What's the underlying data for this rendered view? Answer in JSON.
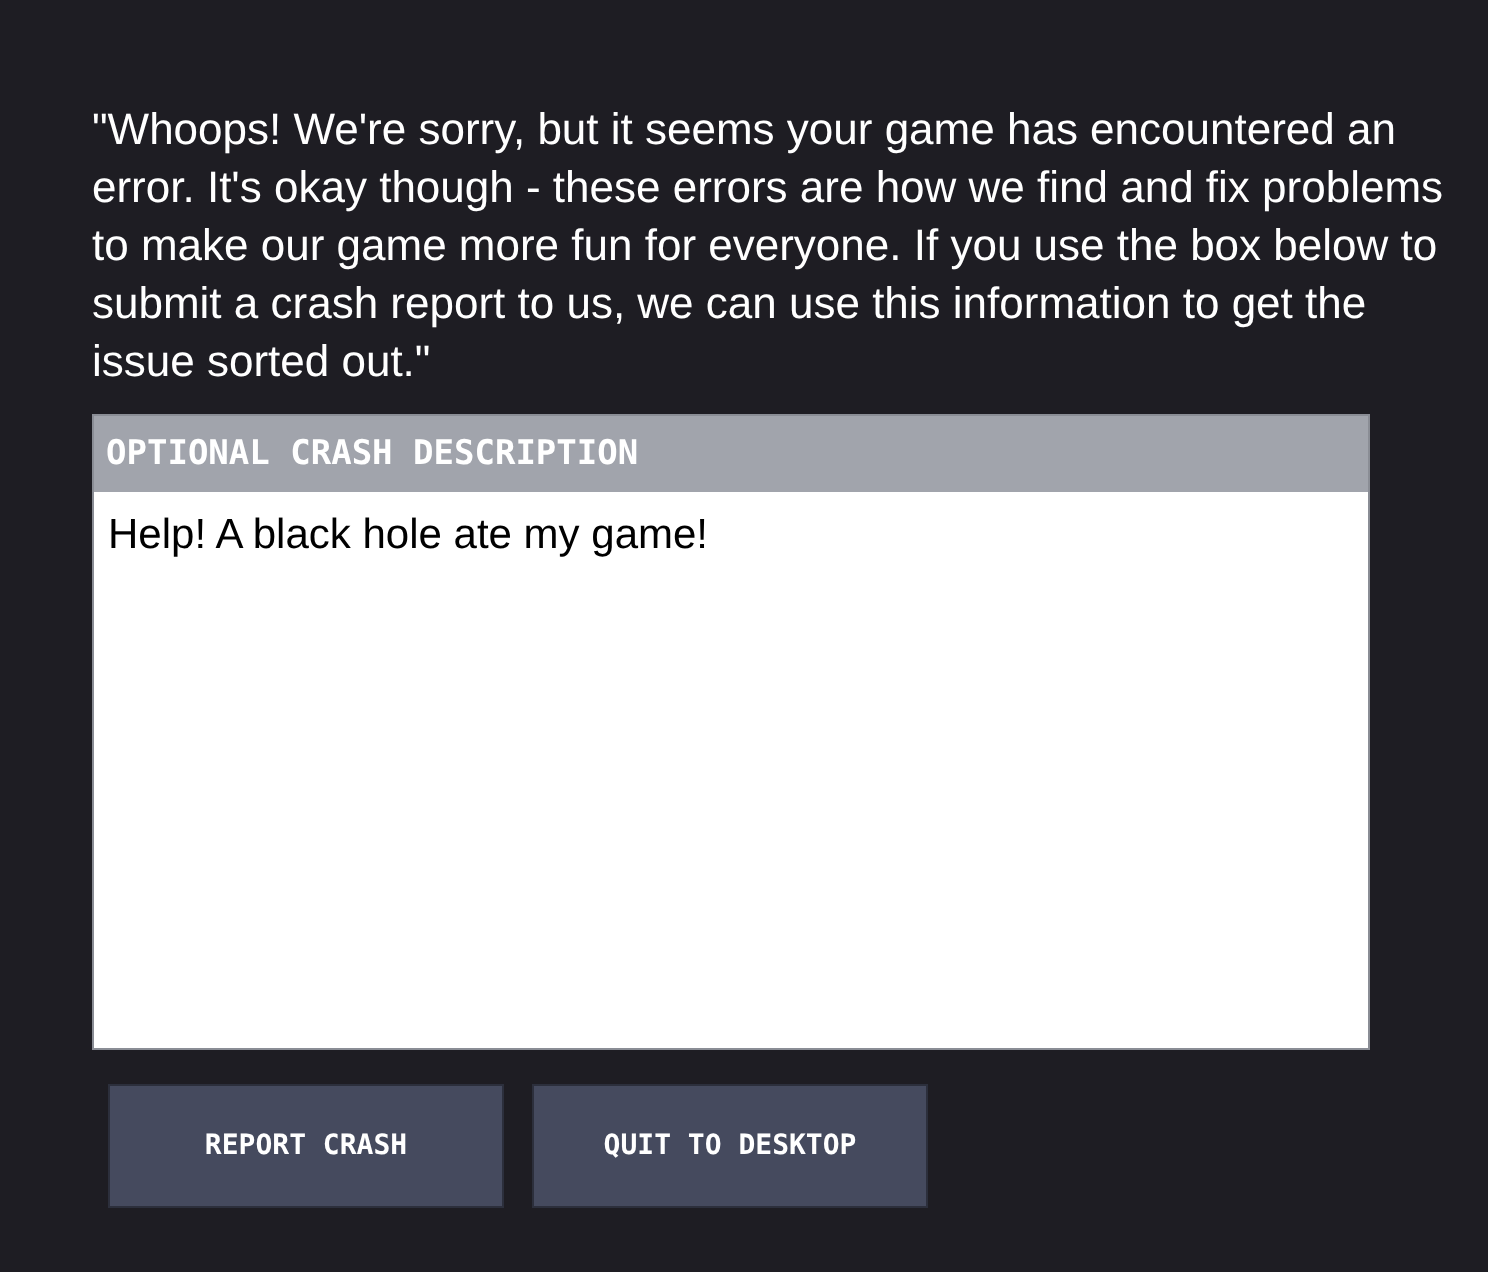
{
  "message": "\"Whoops! We're sorry, but it seems your game has encountered an error. It's okay though - these errors are how we find and fix problems to make our game more fun for everyone. If you use the box below to submit a crash report to us, we can use this information to get the issue sorted out.\"",
  "description_box": {
    "label": "OPTIONAL CRASH DESCRIPTION",
    "value": "Help! A black hole ate my game!"
  },
  "buttons": [
    "REPORT CRASH",
    "QUIT TO DESKTOP"
  ]
}
